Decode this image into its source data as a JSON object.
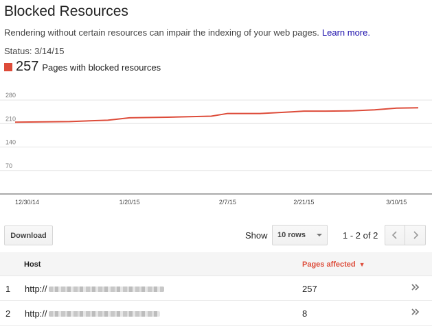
{
  "header": {
    "title": "Blocked Resources",
    "description": "Rendering without certain resources can impair the indexing of your web pages.",
    "learn_more": "Learn more.",
    "status": "Status: 3/14/15"
  },
  "metric": {
    "value": "257",
    "label": "Pages with blocked resources",
    "color": "#dd4b39"
  },
  "chart_data": {
    "type": "line",
    "series": [
      {
        "color": "#dd4b39",
        "values": [
          {
            "x": "12/30/14",
            "y": 214
          },
          {
            "x": "1/9/15",
            "y": 216
          },
          {
            "x": "1/16/15",
            "y": 220
          },
          {
            "x": "1/20/15",
            "y": 227
          },
          {
            "x": "1/27/15",
            "y": 229
          },
          {
            "x": "2/4/15",
            "y": 232
          },
          {
            "x": "2/7/15",
            "y": 240
          },
          {
            "x": "2/13/15",
            "y": 240
          },
          {
            "x": "2/19/15",
            "y": 245
          },
          {
            "x": "2/21/15",
            "y": 247
          },
          {
            "x": "2/25/15",
            "y": 247
          },
          {
            "x": "3/2/15",
            "y": 248
          },
          {
            "x": "3/6/15",
            "y": 251
          },
          {
            "x": "3/10/15",
            "y": 256
          },
          {
            "x": "3/14/15",
            "y": 257
          }
        ]
      }
    ],
    "x_ticks": [
      "12/30/14",
      "1/20/15",
      "2/7/15",
      "2/21/15",
      "3/10/15"
    ],
    "y_ticks": [
      70,
      140,
      210,
      280
    ],
    "ylim": [
      0,
      280
    ],
    "grid": true
  },
  "controls": {
    "download_label": "Download",
    "show_label": "Show",
    "rows_value": "10 rows",
    "pager_text": "1 - 2 of 2"
  },
  "table": {
    "columns": [
      "Host",
      "Pages affected"
    ],
    "sort_indicator": "▼",
    "rows": [
      {
        "index": "1",
        "host": "http://",
        "pages": "257"
      },
      {
        "index": "2",
        "host": "http://",
        "pages": "8"
      }
    ]
  }
}
